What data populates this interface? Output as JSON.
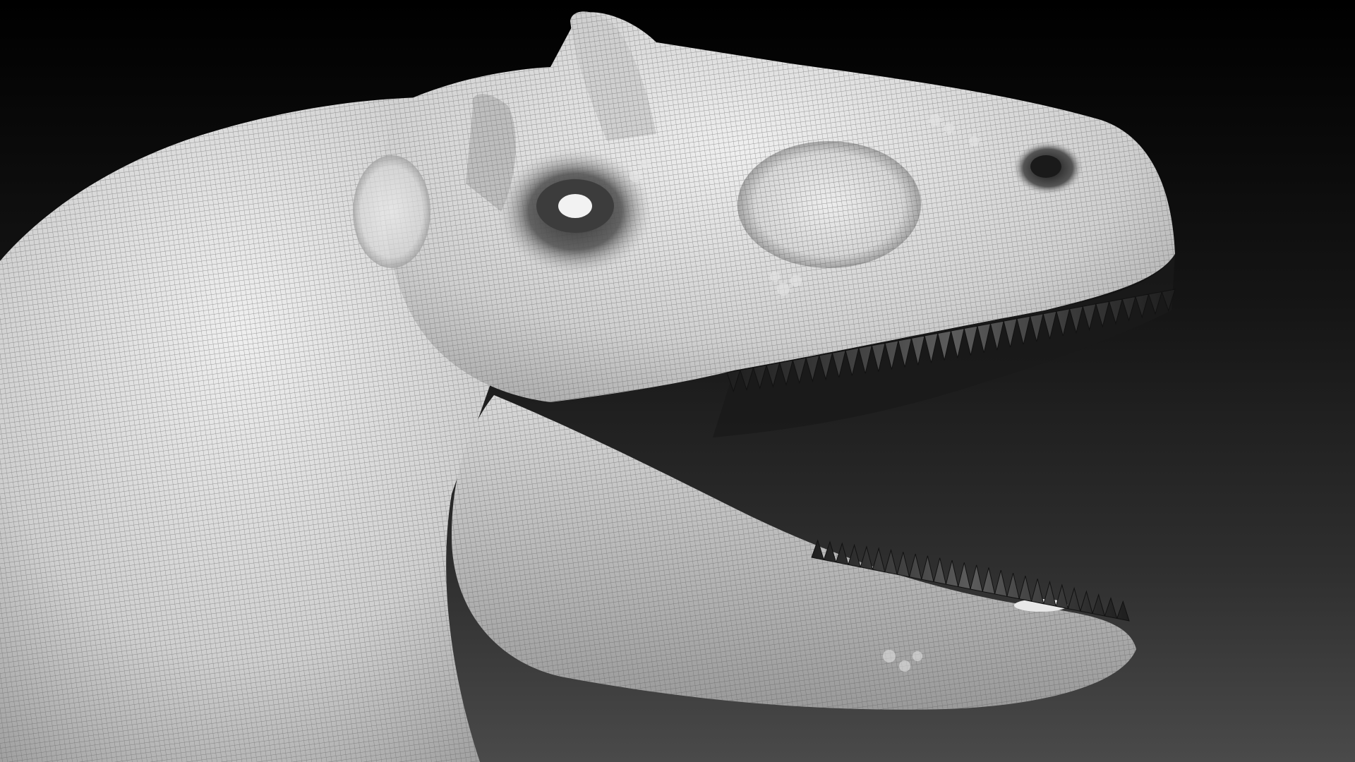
{
  "viewport": {
    "subject": "dinosaur-head-sculpt",
    "background_top_color": "#000000",
    "background_bottom_color": "#4a4a4a",
    "skin_base_color": "#c9c9c9",
    "skin_highlight_color": "#efefef",
    "mesh_wire_color": "#5a5a5a",
    "cavity_color": "#3a3a3a",
    "teeth_color": "#2a2a2a",
    "eye_color": "#f2f2f2"
  }
}
